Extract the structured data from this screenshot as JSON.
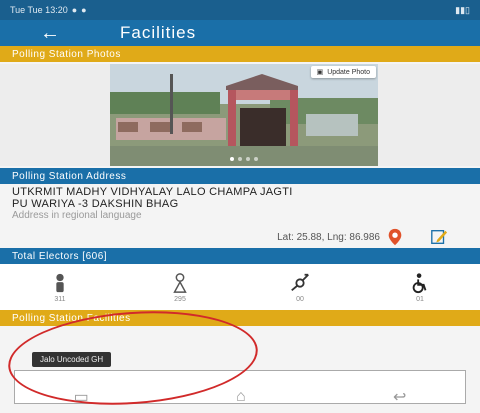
{
  "status_bar": {
    "left": "Tue Tue 13:20",
    "right": ""
  },
  "app_bar": {
    "title": "Facilities",
    "back_icon": "arrow-left-icon"
  },
  "photos": {
    "section_title": "Polling Station Photos",
    "update_button": "Update Photo",
    "slide_count": 4,
    "active_slide": 0
  },
  "address": {
    "section_title": "Polling Station Address",
    "line1": "UTKRMIT MADHY VIDHYALAY LALO CHAMPA JAGTI",
    "line2": "PU WARIYA -3 DAKSHIN BHAG",
    "regional_placeholder": "Address in regional language",
    "latlng": "Lat: 25.88, Lng: 86.986"
  },
  "electors": {
    "section_title": "Total Electors [606]",
    "items": [
      {
        "icon": "male-voter-icon",
        "count": "311"
      },
      {
        "icon": "female-voter-icon",
        "count": "295"
      },
      {
        "icon": "third-gender-icon",
        "count": "00"
      },
      {
        "icon": "pwd-wheelchair-icon",
        "count": "01"
      }
    ]
  },
  "facilities": {
    "section_title": "Polling Station Facilities",
    "tag": "Jalo Uncoded GH"
  },
  "colors": {
    "primary": "#1a6fa8",
    "accent": "#e0aa18",
    "annotation": "#d12a2a"
  }
}
